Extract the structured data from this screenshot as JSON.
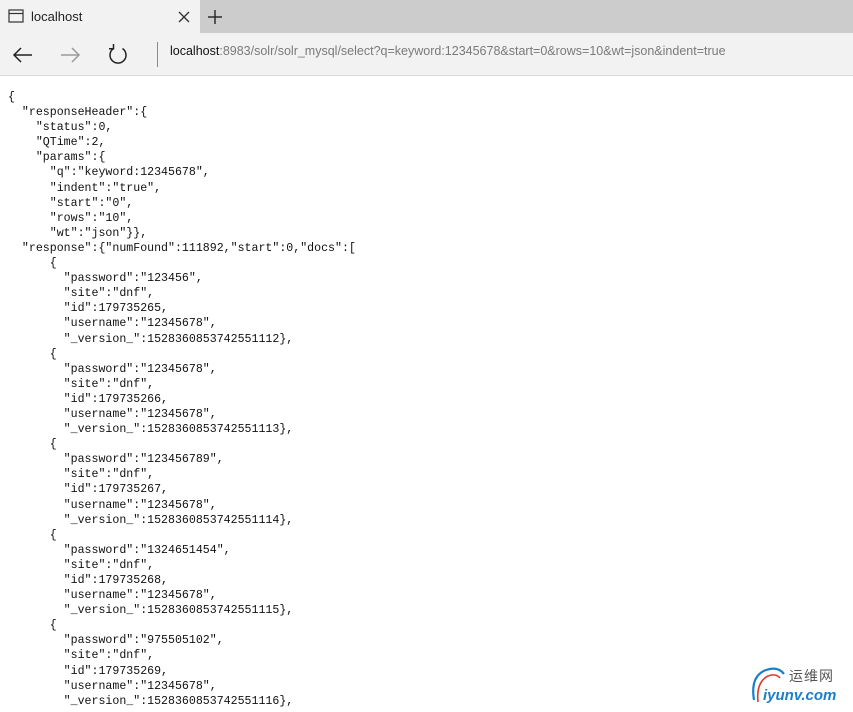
{
  "tab": {
    "title": "localhost",
    "page_icon": "page-icon",
    "close_icon": "close-icon",
    "new_tab_icon": "plus-icon"
  },
  "nav": {
    "back_icon": "arrow-left-icon",
    "forward_icon": "arrow-right-icon",
    "refresh_icon": "refresh-icon",
    "address_host": "localhost",
    "address_rest": ":8983/solr/solr_mysql/select?q=keyword:12345678&start=0&rows=10&wt=json&indent=true"
  },
  "content": {
    "json_text": "{\n  \"responseHeader\":{\n    \"status\":0,\n    \"QTime\":2,\n    \"params\":{\n      \"q\":\"keyword:12345678\",\n      \"indent\":\"true\",\n      \"start\":\"0\",\n      \"rows\":\"10\",\n      \"wt\":\"json\"}},\n  \"response\":{\"numFound\":111892,\"start\":0,\"docs\":[\n      {\n        \"password\":\"123456\",\n        \"site\":\"dnf\",\n        \"id\":179735265,\n        \"username\":\"12345678\",\n        \"_version_\":1528360853742551112},\n      {\n        \"password\":\"12345678\",\n        \"site\":\"dnf\",\n        \"id\":179735266,\n        \"username\":\"12345678\",\n        \"_version_\":1528360853742551113},\n      {\n        \"password\":\"123456789\",\n        \"site\":\"dnf\",\n        \"id\":179735267,\n        \"username\":\"12345678\",\n        \"_version_\":1528360853742551114},\n      {\n        \"password\":\"1324651454\",\n        \"site\":\"dnf\",\n        \"id\":179735268,\n        \"username\":\"12345678\",\n        \"_version_\":1528360853742551115},\n      {\n        \"password\":\"975505102\",\n        \"site\":\"dnf\",\n        \"id\":179735269,\n        \"username\":\"12345678\",\n        \"_version_\":1528360853742551116},"
  },
  "watermark": {
    "cn_text": "运维网",
    "en_text": "iyunv.com"
  },
  "colors": {
    "tabbar_bg": "#cccccc",
    "toolbar_bg": "#f2f2f2",
    "watermark_blue": "#1a7ecb"
  }
}
